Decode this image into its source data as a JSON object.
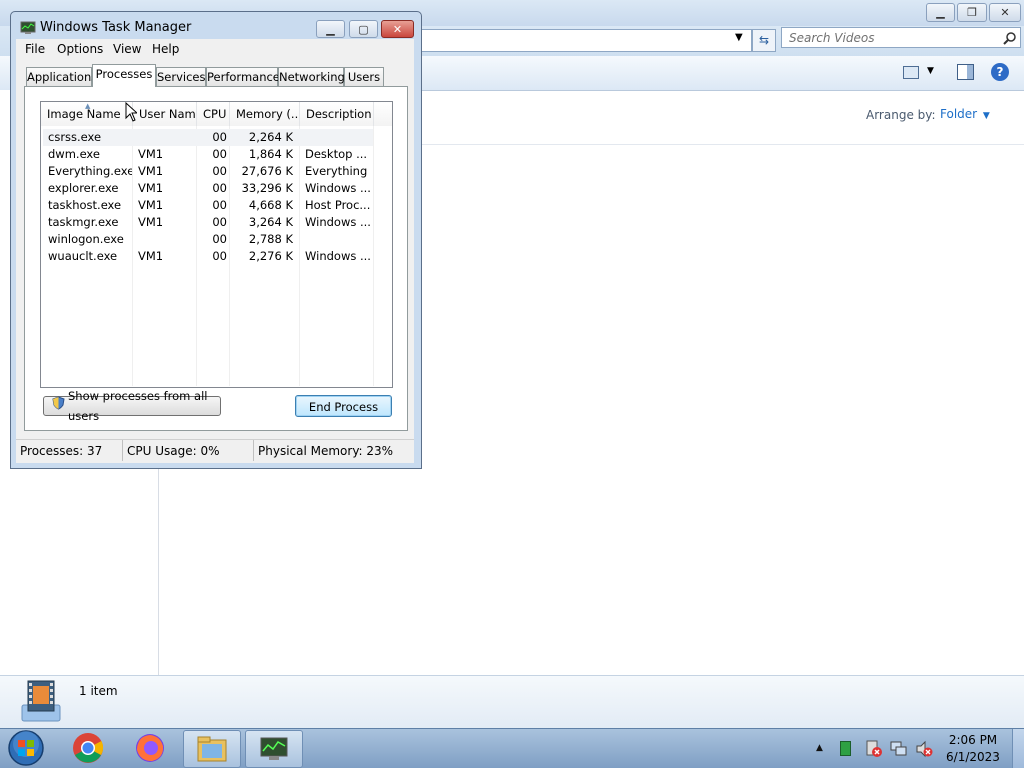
{
  "explorer": {
    "search_placeholder": "Search Videos",
    "arrange_label": "Arrange by:",
    "arrange_value": "Folder",
    "status_count": "1 item"
  },
  "task_manager": {
    "title": "Windows Task Manager",
    "menu": [
      "File",
      "Options",
      "View",
      "Help"
    ],
    "tabs": [
      "Applications",
      "Processes",
      "Services",
      "Performance",
      "Networking",
      "Users"
    ],
    "active_tab": "Processes",
    "columns": [
      "Image Name",
      "User Name",
      "CPU",
      "Memory (...",
      "Description"
    ],
    "processes": [
      {
        "name": "csrss.exe",
        "user": "",
        "cpu": "00",
        "memory": "2,264 K",
        "description": ""
      },
      {
        "name": "dwm.exe",
        "user": "VM1",
        "cpu": "00",
        "memory": "1,864 K",
        "description": "Desktop ..."
      },
      {
        "name": "Everything.exe",
        "user": "VM1",
        "cpu": "00",
        "memory": "27,676 K",
        "description": "Everything"
      },
      {
        "name": "explorer.exe",
        "user": "VM1",
        "cpu": "00",
        "memory": "33,296 K",
        "description": "Windows ..."
      },
      {
        "name": "taskhost.exe",
        "user": "VM1",
        "cpu": "00",
        "memory": "4,668 K",
        "description": "Host Proc..."
      },
      {
        "name": "taskmgr.exe",
        "user": "VM1",
        "cpu": "00",
        "memory": "3,264 K",
        "description": "Windows ..."
      },
      {
        "name": "winlogon.exe",
        "user": "",
        "cpu": "00",
        "memory": "2,788 K",
        "description": ""
      },
      {
        "name": "wuauclt.exe",
        "user": "VM1",
        "cpu": "00",
        "memory": "2,276 K",
        "description": "Windows ..."
      }
    ],
    "show_all_button": "Show processes from all users",
    "end_process_button": "End Process",
    "status": {
      "processes": "Processes: 37",
      "cpu": "CPU Usage: 0%",
      "memory": "Physical Memory: 23%"
    }
  },
  "taskbar": {
    "time": "2:06 PM",
    "date": "6/1/2023"
  },
  "icons": [
    "start-orb-icon",
    "chrome-icon",
    "firefox-icon",
    "folder-icon",
    "task-manager-icon",
    "video-icon",
    "refresh-icon",
    "search-icon",
    "help-icon",
    "shield-icon"
  ],
  "colors": {
    "accent": "#1e6fc8",
    "close_red": "#c9463d"
  }
}
